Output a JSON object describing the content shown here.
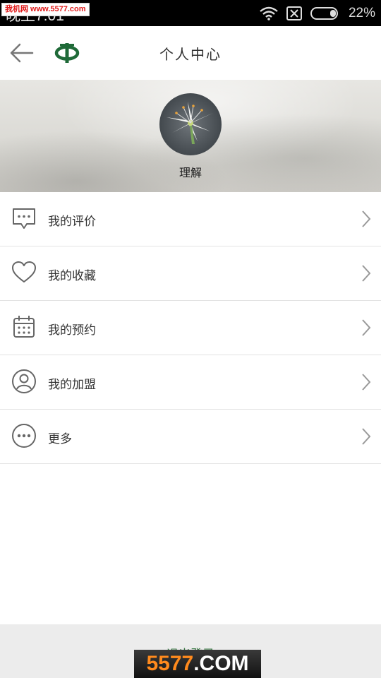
{
  "status_bar": {
    "time": "晚上7:01",
    "battery_percent": "22%",
    "watermark": "我机网 www.5577.com"
  },
  "header": {
    "title": "个人中心"
  },
  "profile": {
    "username": "理解"
  },
  "menu": {
    "items": [
      {
        "label": "我的评价",
        "icon": "comment-icon"
      },
      {
        "label": "我的收藏",
        "icon": "heart-icon"
      },
      {
        "label": "我的预约",
        "icon": "calendar-icon"
      },
      {
        "label": "我的加盟",
        "icon": "user-icon"
      },
      {
        "label": "更多",
        "icon": "more-icon"
      }
    ]
  },
  "footer": {
    "logout_label": "退出登录",
    "watermark_num": "5577",
    "watermark_domain": ".COM"
  },
  "colors": {
    "accent_green": "#3a7a45",
    "logo_green": "#1f6a38"
  }
}
